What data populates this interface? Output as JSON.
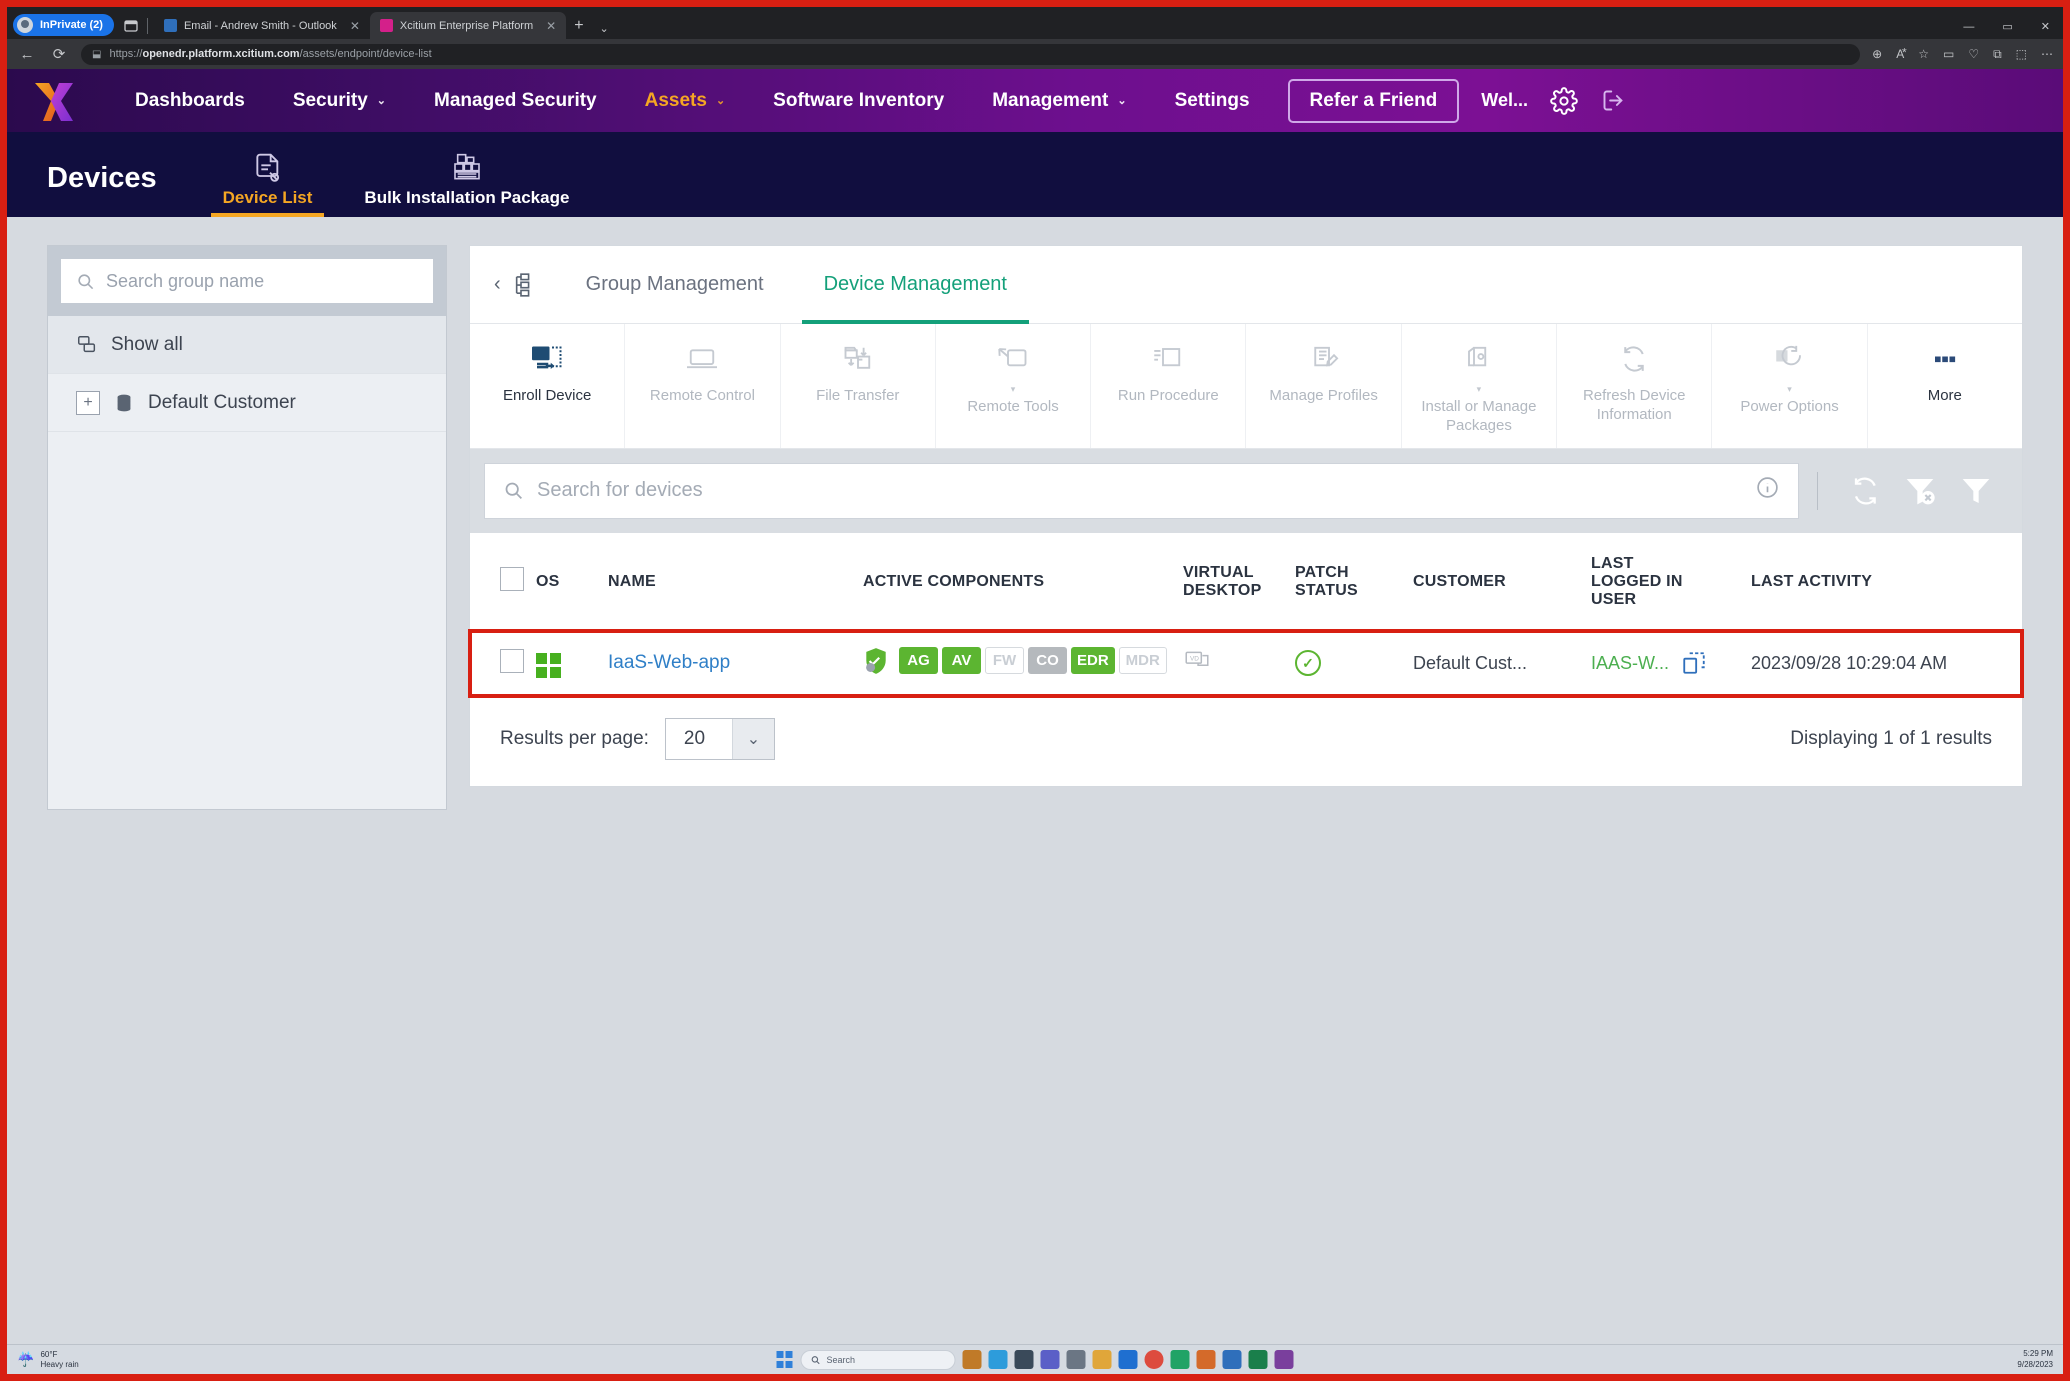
{
  "browser": {
    "private_tab": "InPrivate (2)",
    "tabs": [
      {
        "title": "Email - Andrew Smith - Outlook",
        "favicon": "#2f6fbb",
        "active": false
      },
      {
        "title": "Xcitium Enterprise Platform",
        "favicon": "#d4208a",
        "active": true
      }
    ],
    "newtab_label": "+",
    "tablist_caret": "⌄",
    "back_icon": "←",
    "refresh_icon": "⟳",
    "shield_icon": "⬓",
    "url_bold": "openedr.platform.xcitium.com",
    "url_rest": "/assets/endpoint/device-list",
    "omni_icons": [
      "⊕",
      "A⃰",
      "☆",
      "▭",
      "♡",
      "⧉",
      "⬚",
      "⋯"
    ],
    "window_buttons": [
      "—",
      "▭",
      "✕"
    ]
  },
  "appnav": {
    "logo_name": "xcitium-logo",
    "items": [
      {
        "label": "Dashboards",
        "caret": false
      },
      {
        "label": "Security",
        "caret": true
      },
      {
        "label": "Managed Security",
        "caret": false
      },
      {
        "label": "Assets",
        "caret": true,
        "active": true
      },
      {
        "label": "Software Inventory",
        "caret": false
      },
      {
        "label": "Management",
        "caret": true
      },
      {
        "label": "Settings",
        "caret": false
      }
    ],
    "refer_label": "Refer a Friend",
    "welcome": "Wel...",
    "gear_icon": "gear-icon",
    "logout_icon": "logout-icon"
  },
  "pagehead": {
    "title": "Devices",
    "tabs": [
      {
        "label": "Device List",
        "active": true
      },
      {
        "label": "Bulk Installation Package",
        "active": false
      }
    ]
  },
  "sidebar": {
    "search_placeholder": "Search group name",
    "items": [
      {
        "label": "Show all",
        "icon": "copy-group-icon"
      },
      {
        "label": "Default Customer",
        "icon": "database-icon",
        "expander": "+"
      }
    ]
  },
  "panel": {
    "collapse_icon": "‹",
    "tree_icon": "hierarchy-icon",
    "tabs": [
      {
        "label": "Group Management",
        "active": false
      },
      {
        "label": "Device Management",
        "active": true
      }
    ],
    "toolbar": [
      {
        "label": "Enroll Device",
        "icon": "enroll-device-icon",
        "active": true,
        "dropdown": false
      },
      {
        "label": "Remote Control",
        "icon": "laptop-icon",
        "active": false,
        "dropdown": false
      },
      {
        "label": "File Transfer",
        "icon": "file-transfer-icon",
        "active": false,
        "dropdown": false
      },
      {
        "label": "Remote Tools",
        "icon": "remote-tools-icon",
        "active": false,
        "dropdown": true
      },
      {
        "label": "Run Procedure",
        "icon": "run-procedure-icon",
        "active": false,
        "dropdown": false
      },
      {
        "label": "Manage Profiles",
        "icon": "manage-profiles-icon",
        "active": false,
        "dropdown": false
      },
      {
        "label": "Install or Manage Packages",
        "icon": "install-packages-icon",
        "active": false,
        "dropdown": true
      },
      {
        "label": "Refresh Device Information",
        "icon": "refresh-icon",
        "active": false,
        "dropdown": false
      },
      {
        "label": "Power Options",
        "icon": "power-options-icon",
        "active": false,
        "dropdown": true
      },
      {
        "label": "More",
        "icon": "more-dots-icon",
        "active": true,
        "dropdown": false
      }
    ],
    "device_search_placeholder": "Search for devices",
    "search_info_icon": "info-icon",
    "search_actions": [
      {
        "icon": "refresh-circular-icon",
        "name": "refresh-button"
      },
      {
        "icon": "clear-filter-icon",
        "name": "clear-filter-button"
      },
      {
        "icon": "filter-icon",
        "name": "filter-button"
      }
    ]
  },
  "table": {
    "columns": [
      "",
      "OS",
      "NAME",
      "ACTIVE COMPONENTS",
      "VIRTUAL DESKTOP",
      "PATCH STATUS",
      "CUSTOMER",
      "LAST LOGGED IN USER",
      "LAST ACTIVITY"
    ],
    "rows": [
      {
        "checked": false,
        "os": "windows-icon",
        "name": "IaaS-Web-app",
        "shield_icon": "shield-icon",
        "components": [
          {
            "code": "AG",
            "state": "on"
          },
          {
            "code": "AV",
            "state": "on"
          },
          {
            "code": "FW",
            "state": "off"
          },
          {
            "code": "CO",
            "state": "partial"
          },
          {
            "code": "EDR",
            "state": "on"
          },
          {
            "code": "MDR",
            "state": "off"
          }
        ],
        "virtual_desktop": "vd-icon",
        "patch_status": "ok-check-icon",
        "customer": "Default Cust...",
        "last_user": "IAAS-W...",
        "last_user_icon": "rdp-icon",
        "last_activity": "2023/09/28 10:29:04 AM"
      }
    ]
  },
  "footer": {
    "results_label": "Results per page:",
    "page_size": "20",
    "page_size_caret": "⌄",
    "displaying": "Displaying 1 of 1 results"
  },
  "taskbar": {
    "weather_temp": "60°F",
    "weather_desc": "Heavy rain",
    "search_placeholder": "Search",
    "clock_time": "5:29 PM",
    "clock_date": "9/28/2023",
    "icons": [
      {
        "name": "taskbar-briefcase",
        "color": "#c07a28"
      },
      {
        "name": "taskbar-edge",
        "color": "#2d9cdb"
      },
      {
        "name": "taskbar-file-explorer",
        "color": "#3a4a5a"
      },
      {
        "name": "taskbar-teams",
        "color": "#5b5fc7"
      },
      {
        "name": "taskbar-settings",
        "color": "#6b7684"
      },
      {
        "name": "taskbar-folder",
        "color": "#e0a63a"
      },
      {
        "name": "taskbar-outlook",
        "color": "#1f6fd0"
      },
      {
        "name": "taskbar-chrome",
        "color": "#dd4b3e"
      },
      {
        "name": "taskbar-app-green",
        "color": "#21a366"
      },
      {
        "name": "taskbar-app-orange",
        "color": "#d46a2a"
      },
      {
        "name": "taskbar-app-blue",
        "color": "#2f6fbb"
      },
      {
        "name": "taskbar-excel",
        "color": "#1a7f4b"
      },
      {
        "name": "taskbar-xcitium",
        "color": "#7a3f9d"
      }
    ]
  },
  "colors": {
    "accent_purple": "#6d0f8e",
    "accent_orange": "#f5a623",
    "accent_green": "#14a07a",
    "badge_green": "#5cb531",
    "highlight_red": "#d81f12"
  }
}
